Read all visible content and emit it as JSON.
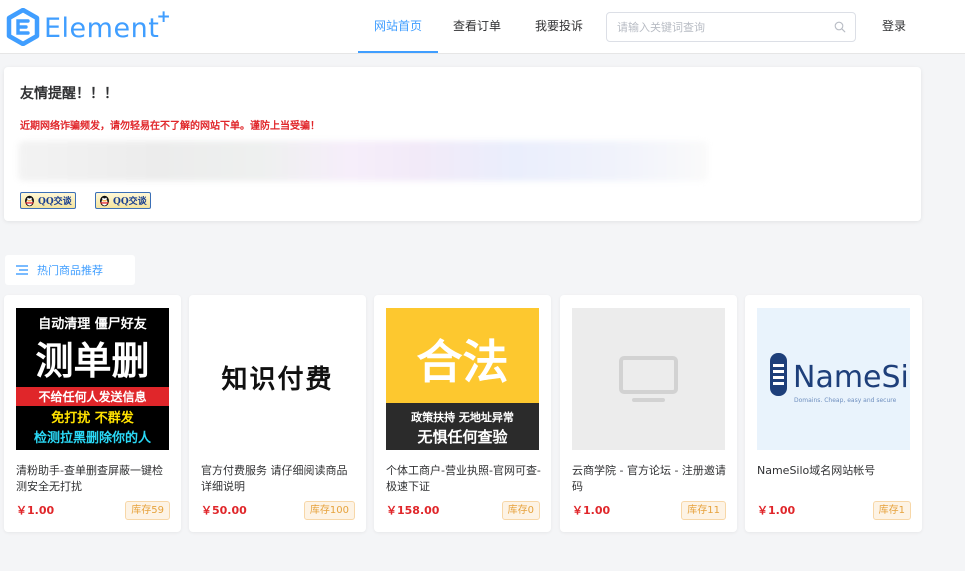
{
  "brand": {
    "name": "Element",
    "plus": "+",
    "color": "#409eff"
  },
  "nav": {
    "home": "网站首页",
    "orders": "查看订单",
    "complaint": "我要投诉",
    "login": "登录"
  },
  "search": {
    "placeholder": "请输入关键词查询",
    "icon": "search-icon"
  },
  "notice": {
    "title": "友情提醒！！！",
    "warning": "近期网络诈骗频发，请勿轻易在不了解的网站下单。谨防上当受骗！",
    "qq_buttons": [
      {
        "label": "QQ交谈"
      },
      {
        "label": "QQ交谈"
      }
    ]
  },
  "section": {
    "title": "热门商品推荐"
  },
  "products": [
    {
      "name": "清粉助手-查单删查屏蔽一键检测安全无打扰",
      "price": "￥1.00",
      "stock": "库存59",
      "image_text": {
        "l1": "自动清理 僵尸好友",
        "big": "测单删",
        "l2": "不给任何人发送信息",
        "l3": "免打扰 不群发",
        "l4": "检测拉黑删除你的人"
      }
    },
    {
      "name": "官方付费服务 请仔细阅读商品详细说明",
      "price": "￥50.00",
      "stock": "库存100",
      "image_text": {
        "big": "知识付费"
      }
    },
    {
      "name": "个体工商户-营业执照-官网可查-极速下证",
      "price": "￥158.00",
      "stock": "库存0",
      "image_text": {
        "big": "合法",
        "l1": "政策扶持 无地址异常",
        "l2": "无惧任何查验"
      }
    },
    {
      "name": "云商学院 - 官方论坛 - 注册邀请码",
      "price": "￥1.00",
      "stock": "库存11",
      "image_text": {}
    },
    {
      "name": "NameSilo域名网站帐号",
      "price": "￥1.00",
      "stock": "库存1",
      "image_text": {
        "big": "NameSilo",
        "l1": "Domains. Cheap, easy and secure"
      }
    }
  ],
  "colors": {
    "accent": "#409eff",
    "price": "#e0262a",
    "stock": "#e6a23c"
  }
}
